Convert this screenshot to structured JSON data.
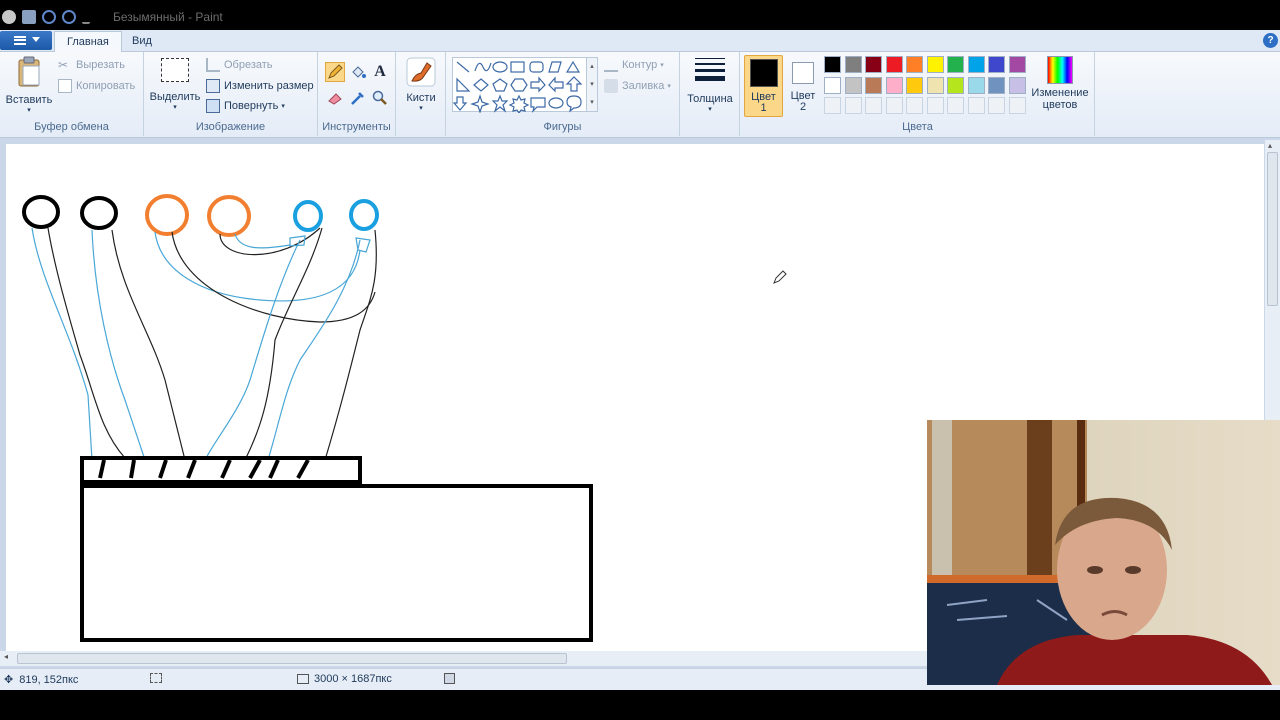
{
  "window": {
    "title": "Безымянный - Paint"
  },
  "menubar": {
    "tabs": [
      {
        "label": "Главная"
      },
      {
        "label": "Вид"
      }
    ],
    "help_glyph": "?"
  },
  "ribbon": {
    "clipboard": {
      "group_label": "Буфер обмена",
      "paste": "Вставить",
      "cut": "Вырезать",
      "copy": "Копировать"
    },
    "image": {
      "group_label": "Изображение",
      "select": "Выделить",
      "crop": "Обрезать",
      "resize": "Изменить размер",
      "rotate": "Повернуть"
    },
    "tools": {
      "group_label": "Инструменты",
      "text_tool_glyph": "A"
    },
    "brushes": {
      "label": "Кисти"
    },
    "shapes": {
      "group_label": "Фигуры",
      "outline": "Контур",
      "fill": "Заливка"
    },
    "size": {
      "label": "Толщина"
    },
    "color1": {
      "label": "Цвет",
      "num": "1",
      "value": "#000000"
    },
    "color2": {
      "label": "Цвет",
      "num": "2",
      "value": "#ffffff"
    },
    "colors": {
      "group_label": "Цвета",
      "palette_row1": [
        "#000000",
        "#7f7f7f",
        "#880015",
        "#ed1c24",
        "#ff7f27",
        "#fff200",
        "#22b14c",
        "#00a2e8",
        "#3f48cc",
        "#a349a4"
      ],
      "palette_row2": [
        "#ffffff",
        "#c3c3c3",
        "#b97a57",
        "#ffaec9",
        "#ffc90e",
        "#efe4b0",
        "#b5e61d",
        "#99d9ea",
        "#7092be",
        "#c8bfe7"
      ],
      "edit_colors": "Изменение цветов"
    }
  },
  "statusbar": {
    "cursor_pos": "819, 152пкс",
    "image_size": "3000 × 1687пкс"
  }
}
